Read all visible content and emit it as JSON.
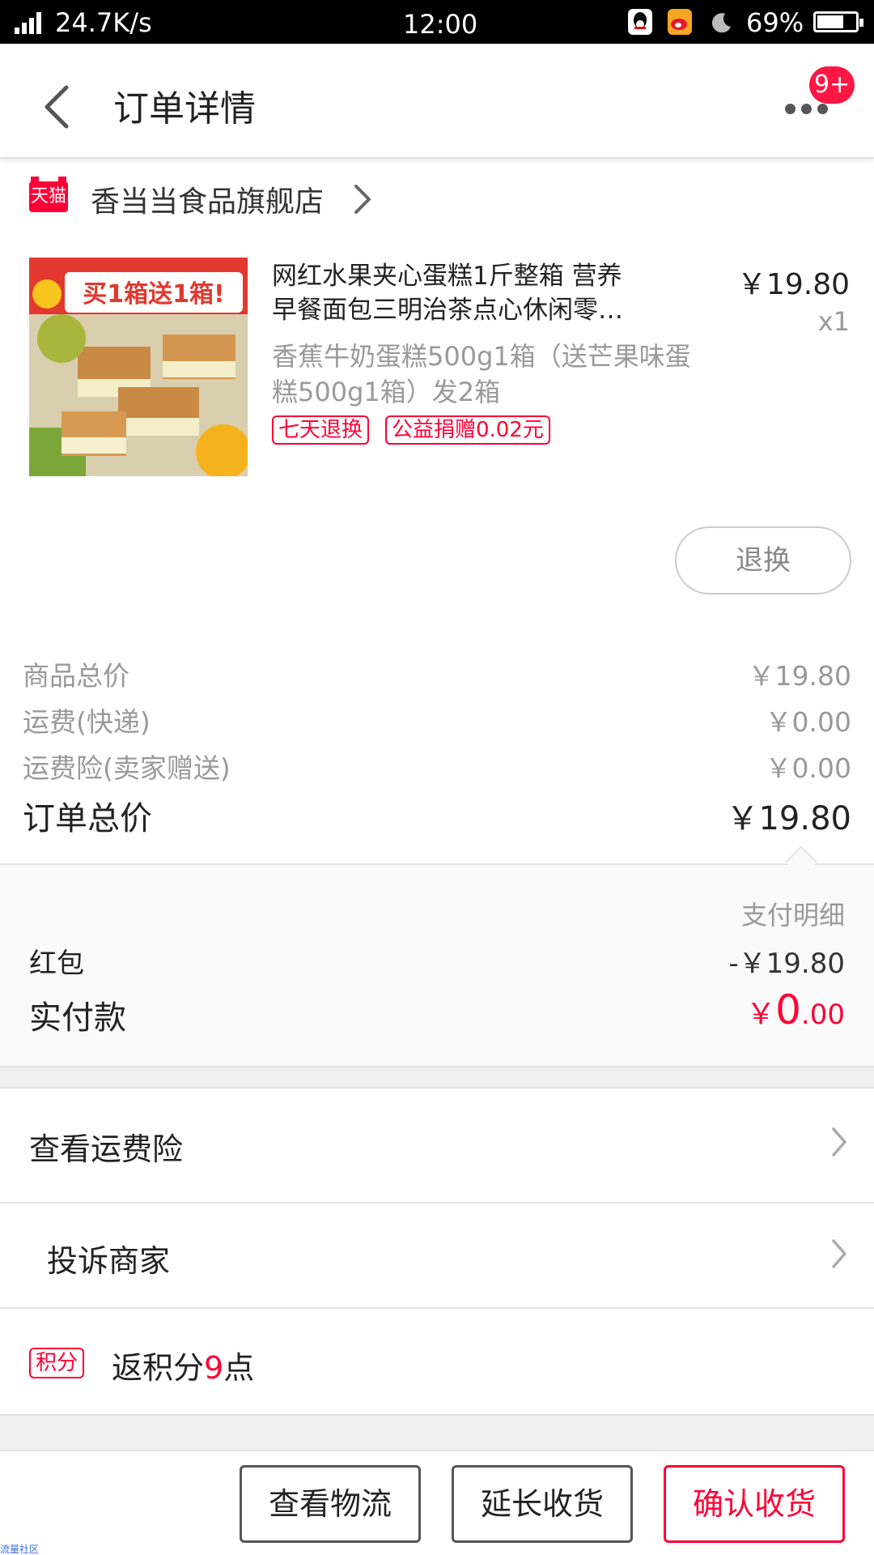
{
  "status_bar": {
    "net_speed": "24.7K/s",
    "time": "12:00",
    "battery_percent": "69%",
    "battery_level": 0.69,
    "icons": [
      "signal-icon",
      "qq-icon",
      "weibo-icon",
      "moon-icon",
      "battery-icon"
    ]
  },
  "header": {
    "title": "订单详情",
    "badge": "9+"
  },
  "shop": {
    "logo_text": "天猫",
    "name": "香当当食品旗舰店"
  },
  "product": {
    "title_line1": "网红水果夹心蛋糕1斤整箱 营养",
    "title_line2": "早餐面包三明治茶点心休闲零…",
    "price": "￥19.80",
    "quantity": "x1",
    "sku": "香蕉牛奶蛋糕500g1箱（送芒果味蛋糕500g1箱）发2箱",
    "tags": [
      "七天退换",
      "公益捐赠0.02元"
    ],
    "image_text": "买1箱送1箱!"
  },
  "actions": {
    "refund": "退换"
  },
  "summary": {
    "rows": [
      {
        "label": "商品总价",
        "value": "￥19.80"
      },
      {
        "label": "运费(快递)",
        "value": "￥0.00"
      },
      {
        "label": "运费险(卖家赠送)",
        "value": "￥0.00"
      }
    ],
    "total_label": "订单总价",
    "total_value": "￥19.80"
  },
  "payment": {
    "detail_title": "支付明细",
    "red_packet_label": "红包",
    "red_packet_value": "-￥19.80",
    "paid_label": "实付款",
    "paid_symbol": "￥",
    "paid_int": "0",
    "paid_dec": ".00"
  },
  "links": {
    "shipping_insurance": "查看运费险",
    "complain": "投诉商家"
  },
  "points": {
    "badge": "积分",
    "prefix": "返积分",
    "count": "9",
    "suffix": "点"
  },
  "bottom_bar": {
    "logistics": "查看物流",
    "extend": "延长收货",
    "confirm": "确认收货"
  },
  "colors": {
    "accent": "#ff0036",
    "text": "#222222",
    "muted": "#999999"
  },
  "watermark": "流量社区"
}
